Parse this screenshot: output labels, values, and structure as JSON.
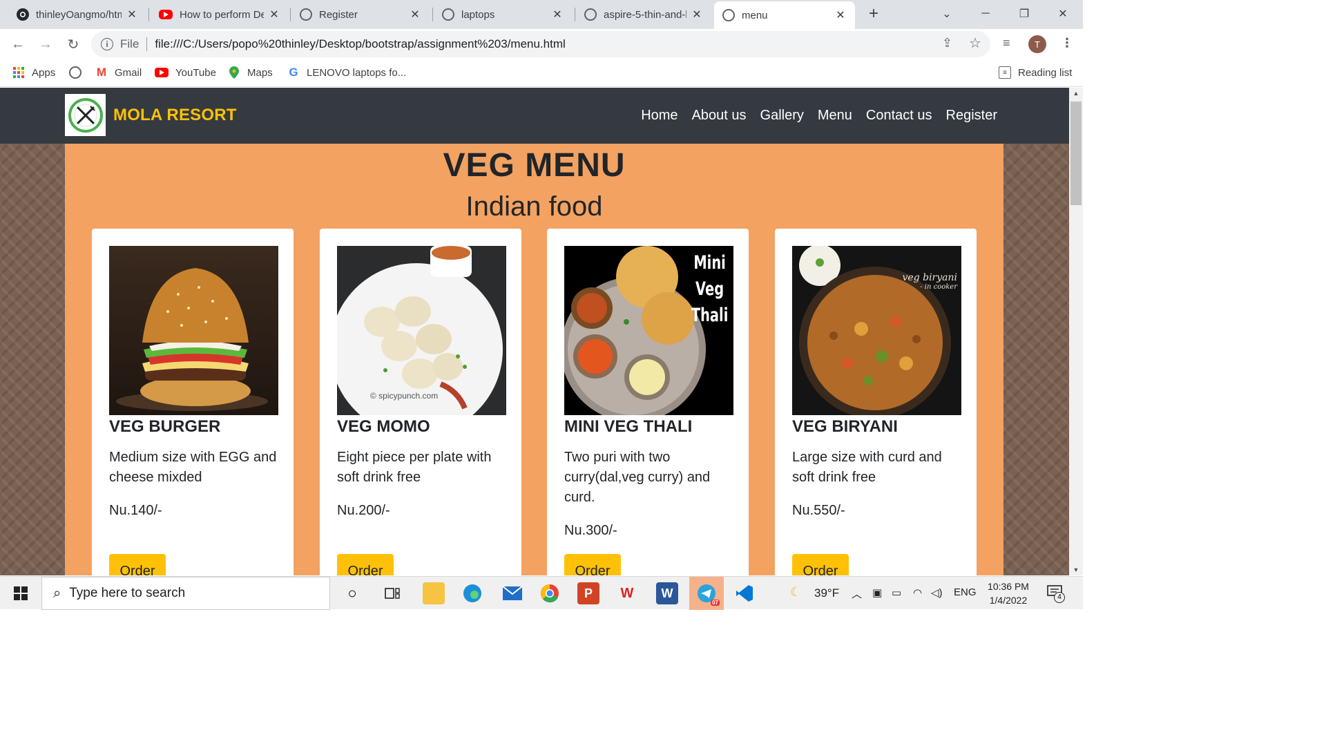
{
  "browser": {
    "tabs": [
      {
        "title": "thinleyOangmo/htm",
        "icon": "github-icon"
      },
      {
        "title": "How to perform De",
        "icon": "youtube-icon"
      },
      {
        "title": "Register",
        "icon": "globe-icon"
      },
      {
        "title": "laptops",
        "icon": "globe-icon"
      },
      {
        "title": "aspire-5-thin-and-li",
        "icon": "globe-icon"
      },
      {
        "title": "menu",
        "icon": "globe-icon",
        "active": true
      }
    ],
    "address": {
      "scheme": "File",
      "url": "file:///C:/Users/popo%20thinley/Desktop/bootstrap/assignment%203/menu.html"
    },
    "profile_initial": "T",
    "bookmarks": [
      {
        "label": "Apps",
        "icon": "apps-grid-icon"
      },
      {
        "label": "",
        "icon": "globe-icon"
      },
      {
        "label": "Gmail",
        "icon": "gmail-icon"
      },
      {
        "label": "YouTube",
        "icon": "youtube-icon"
      },
      {
        "label": "Maps",
        "icon": "maps-pin-icon"
      },
      {
        "label": "LENOVO laptops fo...",
        "icon": "google-icon"
      }
    ],
    "reading_list": "Reading list"
  },
  "site": {
    "brand": "MOLA RESORT",
    "nav": [
      "Home",
      "About us",
      "Gallery",
      "Menu",
      "Contact us",
      "Register"
    ],
    "title": "VEG MENU",
    "subtitle": "Indian food",
    "dishes": [
      {
        "name": "VEG BURGER",
        "desc": "Medium size with EGG and cheese mixded",
        "price": "Nu.140/-",
        "order": "Order",
        "image": "veg-burger-photo"
      },
      {
        "name": "VEG MOMO",
        "desc": "Eight piece per plate with soft drink free",
        "price": "Nu.200/-",
        "order": "Order",
        "image": "veg-momo-photo",
        "watermark": "© spicypunch.com"
      },
      {
        "name": "MINI VEG THALI",
        "desc": "Two puri with two curry(dal,veg curry) and curd.",
        "price": "Nu.300/-",
        "order": "Order",
        "image": "mini-veg-thali-photo",
        "overlay": [
          "Mini",
          "Veg",
          "Thali"
        ]
      },
      {
        "name": "VEG BIRYANI",
        "desc": "Large size with curd and soft drink free",
        "price": "Nu.550/-",
        "order": "Order",
        "image": "veg-biryani-photo",
        "overlay": [
          "veg biryani",
          "- in cooker"
        ]
      }
    ],
    "colors": {
      "navbar": "#343a40",
      "brand": "#ffc107",
      "panel": "#f4a261",
      "button": "#ffc107"
    }
  },
  "taskbar": {
    "search_placeholder": "Type here to search",
    "weather": "39°F",
    "language": "ENG",
    "time": "10:36 PM",
    "date": "1/4/2022",
    "notifications": "4",
    "telegram_badge": "07"
  }
}
